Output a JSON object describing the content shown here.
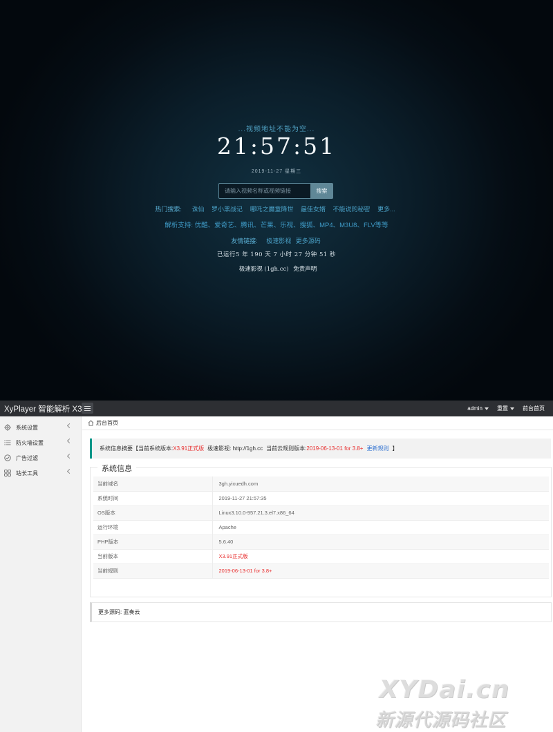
{
  "front": {
    "notice": "...视频地址不能为空...",
    "clock": "21:57:51",
    "date": "2019-11-27 星期三",
    "search": {
      "placeholder": "请输入视频名称或视频链接",
      "button_label": "搜索"
    },
    "hot": {
      "label": "热门搜索:",
      "keywords": [
        "诛仙",
        "罗小黑战记",
        "哪吒之魔童降世",
        "最佳女婿",
        "不能说的秘密",
        "更多..."
      ]
    },
    "support": "解析支持: 优酷、爱奇艺、腾讯、芒果、乐视、搜狐、MP4、M3U8、FLV等等",
    "friends": {
      "label": "友情链接:",
      "links": [
        "极速影视",
        "更多源码"
      ]
    },
    "uptime": "已运行5 年 190 天 7 小时 27 分钟 51 秒",
    "footer": {
      "site": "极速影视 (1gh.cc)",
      "disclaimer": "免责声明"
    }
  },
  "admin": {
    "brand": "XyPlayer 智能解析 X3",
    "topbar": {
      "user": "admin",
      "reset": "重置",
      "home": "前台首页"
    },
    "sidebar": [
      {
        "label": "系统设置",
        "icon": "gear-icon"
      },
      {
        "label": "防火墙设置",
        "icon": "list-icon"
      },
      {
        "label": "广告过滤",
        "icon": "circle-check-icon"
      },
      {
        "label": "站长工具",
        "icon": "grid-icon"
      }
    ],
    "breadcrumb": "后台首页",
    "summary": {
      "prefix": "系统信息摘要【当前系统版本:",
      "version": "X3.91正式版",
      "site_label": "极速影视: http://1gh.cc",
      "rule_label": "当前云规则版本:",
      "rule_version": "2019-06-13-01 for 3.8+",
      "update_link": "更新规则",
      "suffix": "】"
    },
    "system_info": {
      "legend": "系统信息",
      "rows": [
        {
          "key": "当前域名",
          "value": "3gh.yixuedh.com",
          "highlight": false
        },
        {
          "key": "系统时间",
          "value": "2019-11-27 21:57:35",
          "highlight": false
        },
        {
          "key": "OS版本",
          "value": "Linux3.10.0-957.21.3.el7.x86_64",
          "highlight": false
        },
        {
          "key": "运行环境",
          "value": "Apache",
          "highlight": false
        },
        {
          "key": "PHP版本",
          "value": "5.6.40",
          "highlight": false
        },
        {
          "key": "当前版本",
          "value": "X3.91正式版",
          "highlight": true
        },
        {
          "key": "当前规则",
          "value": "2019-06-13-01 for 3.8+",
          "highlight": true
        }
      ]
    },
    "more_source": "更多源码: 蓝奏云",
    "colors": {
      "accent": "#009688",
      "highlight": "#e82d2d",
      "link": "#2c6fd0",
      "topbar": "#2d2f33"
    }
  },
  "watermark": {
    "line1": "XYDai.cn",
    "line2": "新源代源码社区"
  }
}
